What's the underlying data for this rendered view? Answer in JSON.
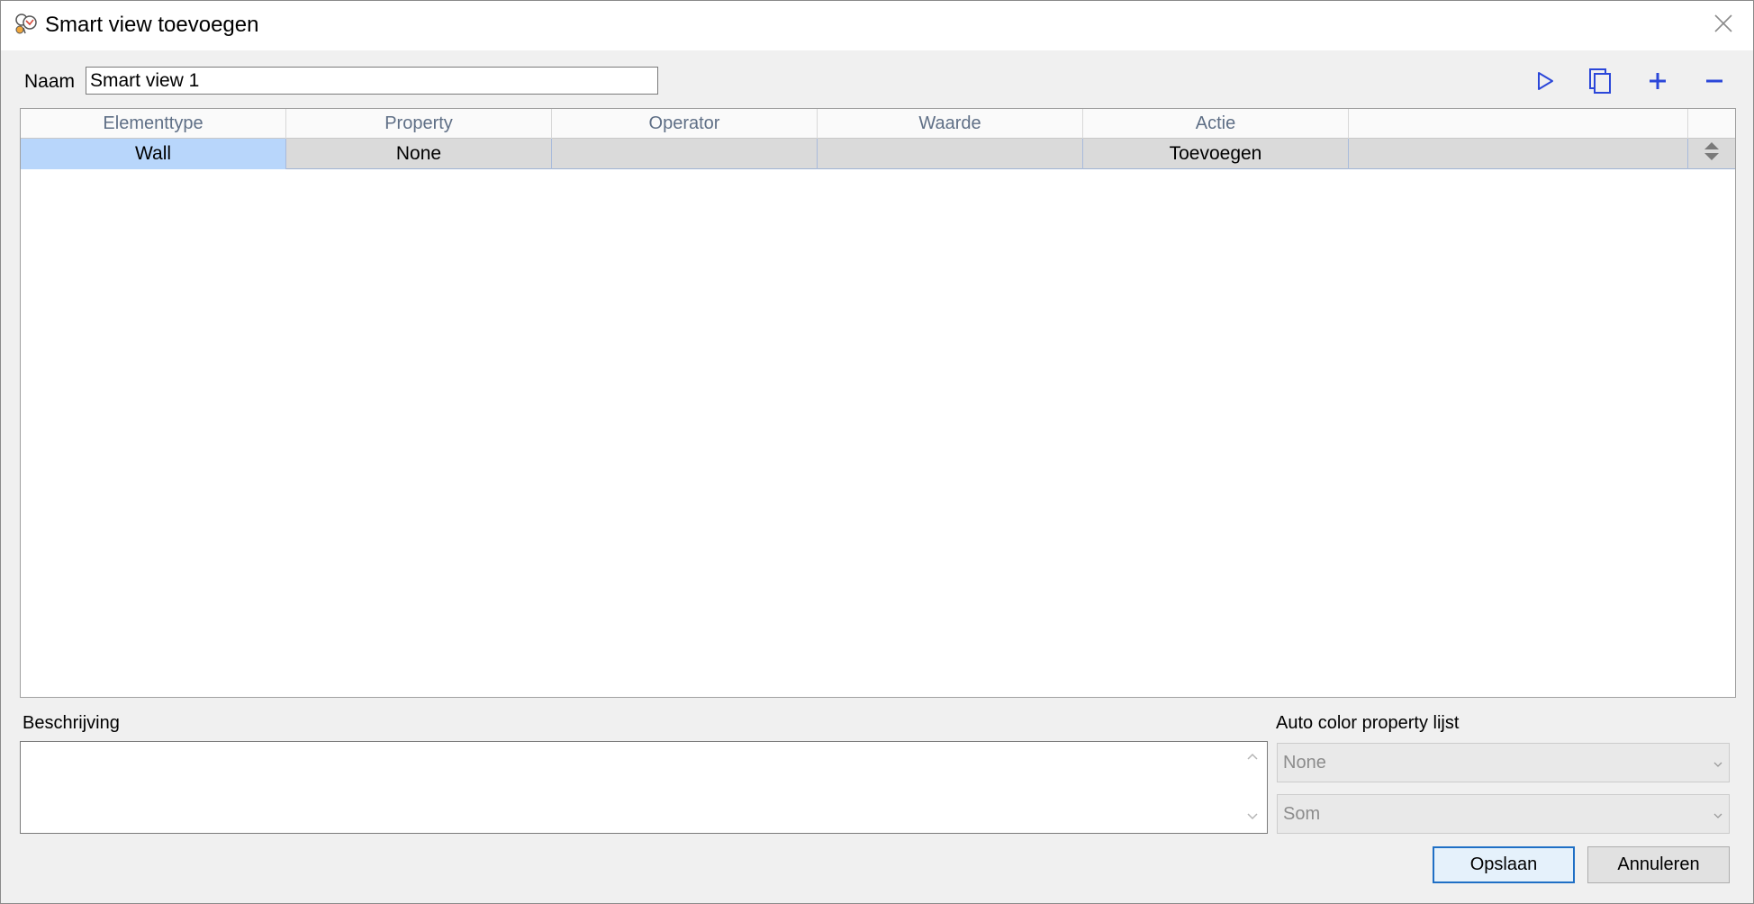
{
  "window": {
    "title": "Smart view toevoegen"
  },
  "form": {
    "naam_label": "Naam",
    "naam_value": "Smart view 1"
  },
  "toolbar": {
    "accent": "#2b47d9"
  },
  "grid": {
    "columns": [
      "Elementtype",
      "Property",
      "Operator",
      "Waarde",
      "Actie",
      "",
      ""
    ],
    "rows": [
      {
        "elementtype": "Wall",
        "property": "None",
        "operator": "",
        "waarde": "",
        "actie": "Toevoegen"
      }
    ]
  },
  "description": {
    "label": "Beschrijving",
    "value": ""
  },
  "auto_color": {
    "label": "Auto color property lijst",
    "property_selected": "None",
    "aggregate_selected": "Som"
  },
  "buttons": {
    "save": "Opslaan",
    "cancel": "Annuleren"
  }
}
